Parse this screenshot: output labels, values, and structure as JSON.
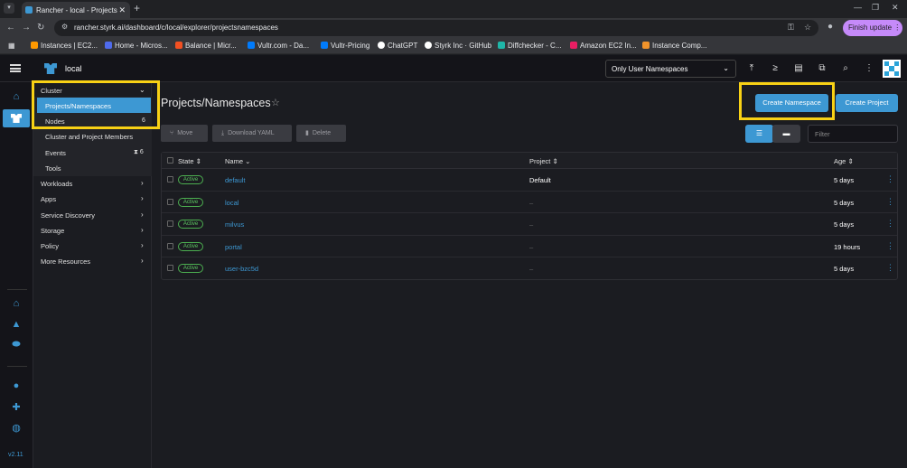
{
  "browser": {
    "tab_title": "Rancher - local - Projects",
    "url": "rancher.styrk.ai/dashboard/c/local/explorer/projectsnamespaces",
    "finish_update": "Finish update",
    "bookmarks": [
      {
        "label": "Instances | EC2...",
        "color": "#ff9900"
      },
      {
        "label": "Home - Micros...",
        "color": "#4f6bed"
      },
      {
        "label": "Balance | Micr...",
        "color": "#f25022"
      },
      {
        "label": "Vultr.com - Da...",
        "color": "#007bfc"
      },
      {
        "label": "Vultr-Pricing",
        "color": "#007bfc"
      },
      {
        "label": "ChatGPT",
        "color": "#ffffff"
      },
      {
        "label": "Styrk Inc · GitHub",
        "color": "#ffffff"
      },
      {
        "label": "Diffchecker - C...",
        "color": "#1fb6a8"
      },
      {
        "label": "Amazon EC2 In...",
        "color": "#e91e63"
      },
      {
        "label": "Instance Comp...",
        "color": "#f0932b"
      }
    ]
  },
  "header": {
    "cluster_name": "local",
    "namespace_filter": "Only User Namespaces",
    "icons": [
      "upload-icon",
      "terminal-icon",
      "file-icon",
      "copy-icon",
      "search-icon",
      "more-icon"
    ]
  },
  "rail": {
    "version": "v2.11"
  },
  "sidenav": {
    "cluster_label": "Cluster",
    "sub_items": [
      {
        "label": "Projects/Namespaces",
        "count": ""
      },
      {
        "label": "Nodes",
        "count": "6"
      },
      {
        "label": "Cluster and Project Members",
        "count": ""
      },
      {
        "label": "Events",
        "count": "6"
      },
      {
        "label": "Tools",
        "count": ""
      }
    ],
    "groups": [
      "Workloads",
      "Apps",
      "Service Discovery",
      "Storage",
      "Policy",
      "More Resources"
    ]
  },
  "main": {
    "title": "Projects/Namespaces",
    "create_namespace": "Create Namespace",
    "create_project": "Create Project",
    "move": "Move",
    "download_yaml": "Download YAML",
    "delete": "Delete",
    "filter_placeholder": "Filter",
    "columns": {
      "state": "State",
      "name": "Name",
      "project": "Project",
      "age": "Age"
    },
    "rows": [
      {
        "state": "Active",
        "name": "default",
        "project": "Default",
        "age": "5 days"
      },
      {
        "state": "Active",
        "name": "local",
        "project": "–",
        "age": "5 days"
      },
      {
        "state": "Active",
        "name": "milvus",
        "project": "–",
        "age": "5 days"
      },
      {
        "state": "Active",
        "name": "portal",
        "project": "–",
        "age": "19 hours"
      },
      {
        "state": "Active",
        "name": "user-bzc5d",
        "project": "–",
        "age": "5 days"
      }
    ]
  }
}
